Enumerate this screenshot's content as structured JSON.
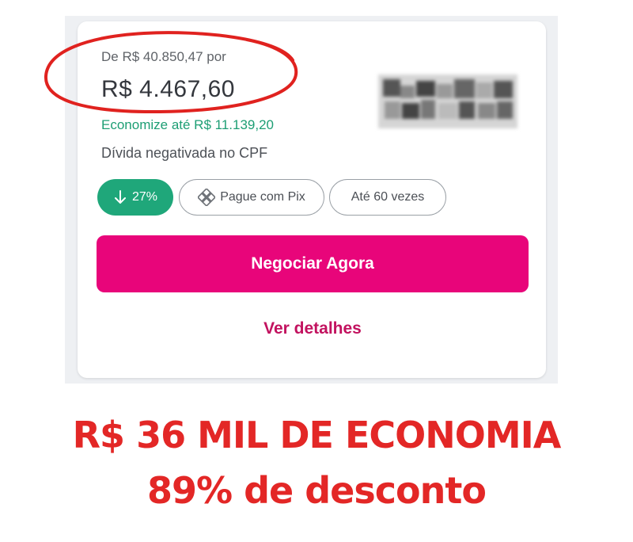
{
  "offer": {
    "old_price_label": "De R$ 40.850,47 por",
    "price": "R$ 4.467,60",
    "savings_label": "Economize até R$ 11.139,20",
    "debt_label": "Dívida negativada no CPF"
  },
  "chips": {
    "discount": "27%",
    "pix": "Pague com Pix",
    "installments": "Até 60 vezes"
  },
  "actions": {
    "primary_label": "Negociar Agora",
    "details_label": "Ver detalhes"
  },
  "headline": {
    "line1": "R$ 36 MIL DE ECONOMIA",
    "line2": "89% de desconto"
  },
  "icons": {
    "discount_icon": "arrow-down-icon",
    "pix_icon": "pix-icon"
  },
  "colors": {
    "accent_pink": "#e8057a",
    "link_pink": "#c2125f",
    "discount_green": "#1fa77a",
    "savings_green": "#1d9e74",
    "headline_red": "#e32726",
    "annotation_red": "#e0221f"
  }
}
